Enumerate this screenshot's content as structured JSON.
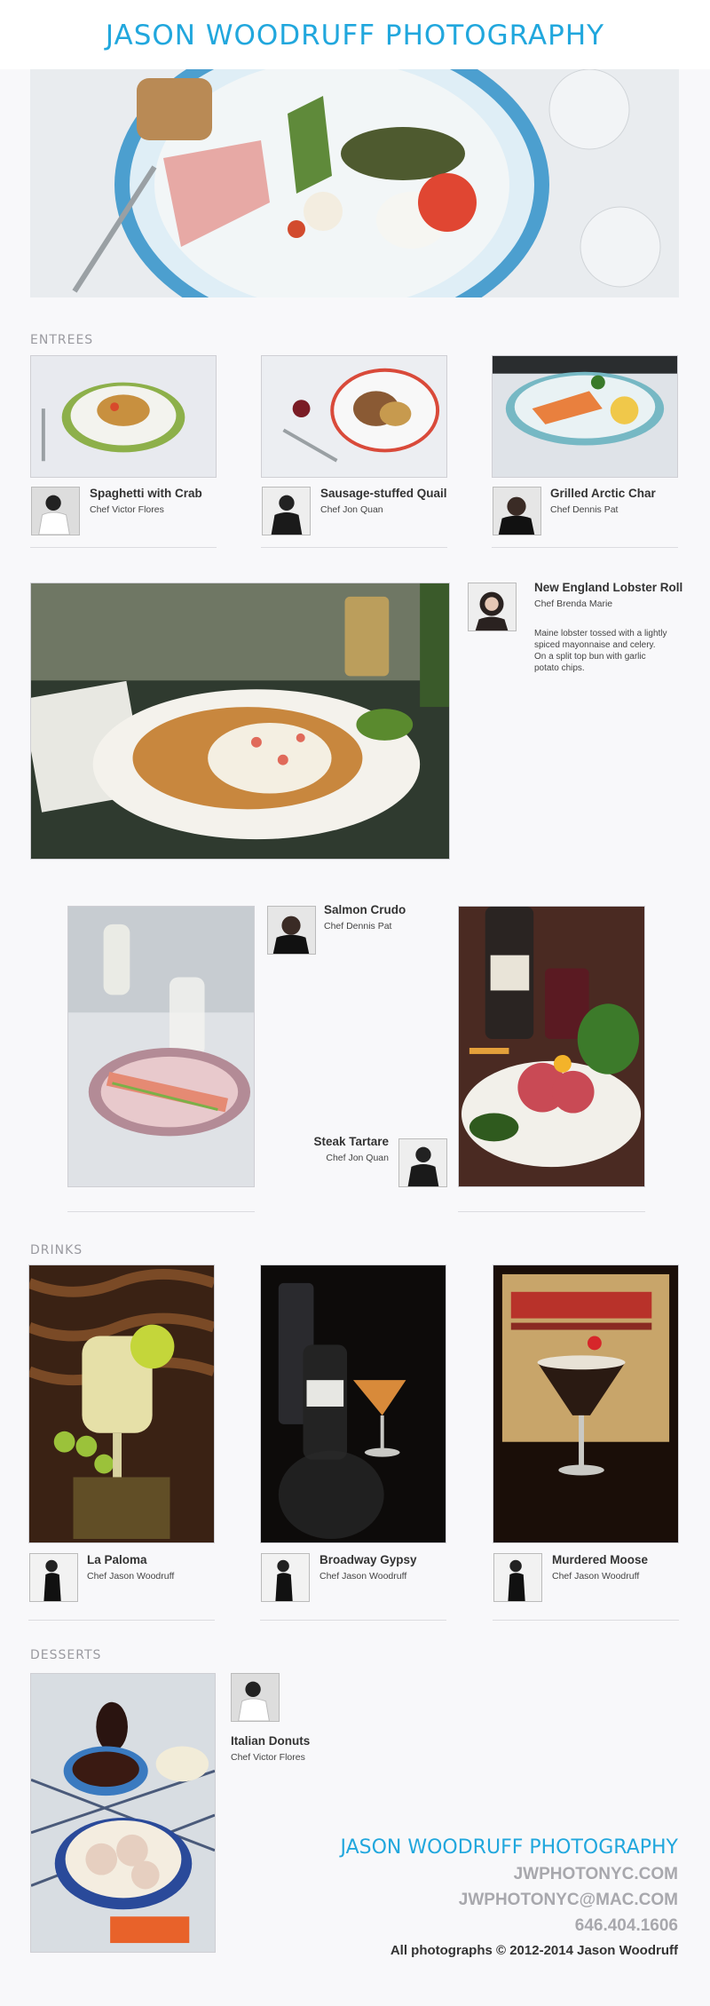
{
  "site": {
    "title": "JASON WOODRUFF PHOTOGRAPHY"
  },
  "sections": {
    "entrees": "ENTREES",
    "drinks": "DRINKS",
    "desserts": "DESSERTS"
  },
  "entrees": [
    {
      "name": "Spaghetti with Crab",
      "chef": "Chef Victor Flores"
    },
    {
      "name": "Sausage-stuffed Quail",
      "chef": "Chef Jon Quan"
    },
    {
      "name": "Grilled Arctic Char",
      "chef": "Chef Dennis Pat"
    }
  ],
  "feature": {
    "name": "New England Lobster Roll",
    "chef": "Chef Brenda Marie",
    "description": "Maine lobster tossed with a lightly spiced mayonnaise and celery. On a split top bun with garlic potato chips."
  },
  "crudo": {
    "name": "Salmon Crudo",
    "chef": "Chef Dennis Pat"
  },
  "tartare": {
    "name": "Steak Tartare",
    "chef": "Chef Jon Quan"
  },
  "drinks": [
    {
      "name": "La Paloma",
      "chef": "Chef Jason Woodruff"
    },
    {
      "name": "Broadway Gypsy",
      "chef": "Chef Jason Woodruff"
    },
    {
      "name": "Murdered Moose",
      "chef": "Chef Jason Woodruff"
    }
  ],
  "dessert": {
    "name": "Italian Donuts",
    "chef": "Chef Victor Flores"
  },
  "footer": {
    "title": "JASON WOODRUFF PHOTOGRAPHY",
    "website": "JWPHOTONYC.COM",
    "email": "JWPHOTONYC@MAC.COM",
    "phone": "646.404.1606",
    "copyright": "All photographs © 2012-2014 Jason Woodruff"
  },
  "colors": {
    "accent": "#21a7dd",
    "muted": "#a8a8ad",
    "background": "#f8f8fa"
  }
}
